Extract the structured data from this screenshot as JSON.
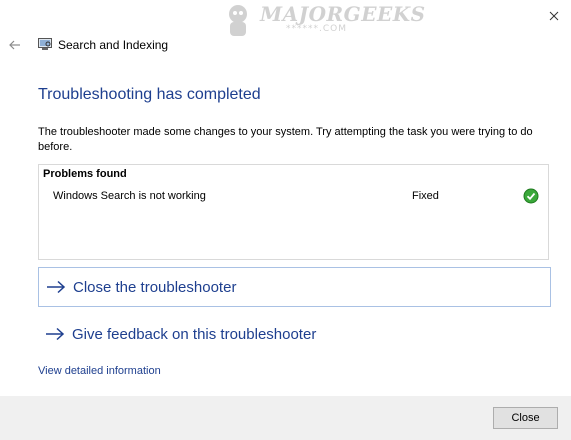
{
  "watermark": {
    "text": "MAJORGEEKS",
    "sub": "******.COM"
  },
  "window": {
    "title": "Search and Indexing"
  },
  "heading": "Troubleshooting has completed",
  "description": "The troubleshooter made some changes to your system. Try attempting the task you were trying to do before.",
  "problems": {
    "header": "Problems found",
    "items": [
      {
        "name": "Windows Search is not working",
        "status": "Fixed",
        "status_color": "#2e9c2e"
      }
    ]
  },
  "actions": [
    {
      "label": "Close the troubleshooter"
    },
    {
      "label": "Give feedback on this troubleshooter"
    }
  ],
  "detail_link": "View detailed information",
  "footer": {
    "close_label": "Close"
  },
  "colors": {
    "accent": "#1e3f8f",
    "link": "#1e3f8f",
    "footer_bg": "#f0f0f0"
  },
  "icons": {
    "back": "back-arrow-icon",
    "close": "close-icon",
    "app": "search-indexing-icon",
    "check": "check-circle-icon",
    "action_arrow": "arrow-right-icon"
  }
}
